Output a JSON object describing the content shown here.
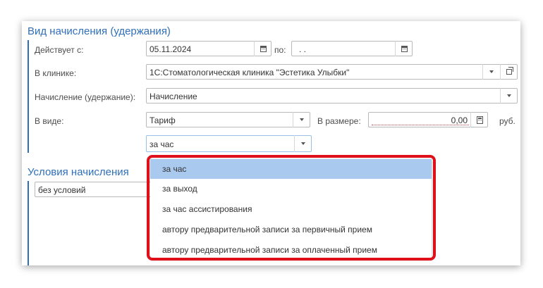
{
  "section1": {
    "title": "Вид начисления (удержания)",
    "effective_from_label": "Действует с:",
    "effective_from_value": "05.11.2024",
    "to_label": "по:",
    "to_value": ". .",
    "clinic_label": "В клинике:",
    "clinic_value": "1С:Стоматологическая клиника \"Эстетика Улыбки\"",
    "accrual_label": "Начисление (удержание):",
    "accrual_value": "Начисление",
    "form_label": "В виде:",
    "form_value": "Тариф",
    "amount_label": "В размере:",
    "amount_value": "0,00",
    "currency": "руб.",
    "unit_value": "за час"
  },
  "section2": {
    "title": "Условия начисления",
    "condition_value": "без условий"
  },
  "dropdown": {
    "items": [
      "за час",
      "за выход",
      "за час ассистирования",
      "автору предварительной записи за первичный прием",
      "автору предварительной записи за оплаченный прием"
    ],
    "selected_index": 0
  },
  "colors": {
    "accent": "#2f6fb8",
    "selection": "#a9c9ee",
    "highlight": "#e0101a"
  }
}
